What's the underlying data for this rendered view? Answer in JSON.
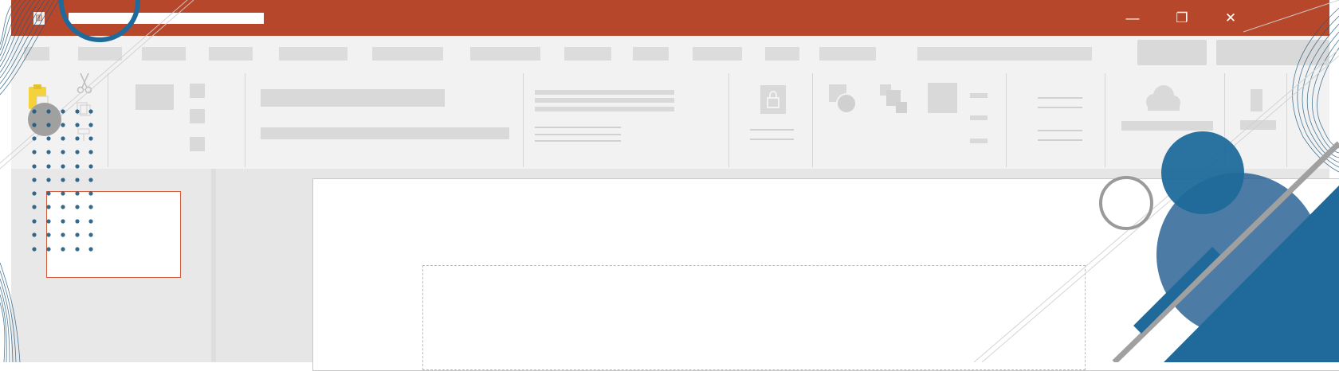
{
  "window": {
    "app_icon": "app-icon",
    "controls": [
      "minimize-icon",
      "restore-icon",
      "close-icon"
    ],
    "title_color": "#b7472a"
  },
  "colors": {
    "titlebar": "#b7472a",
    "menubar": "#f2f2f2",
    "ribbon": "#f2f2f2",
    "workspace": "#e6e6e6",
    "selection": "#d25c3e",
    "deco_blue": "#1f6a9a",
    "deco_gray": "#a0a0a0",
    "clipboard_yellow": "#f3d23b"
  },
  "ribbon": {
    "icons": [
      "clipboard-icon",
      "scissors-icon",
      "lock-icon",
      "shapes-icon",
      "arrange-icon",
      "cloud-icon"
    ]
  }
}
